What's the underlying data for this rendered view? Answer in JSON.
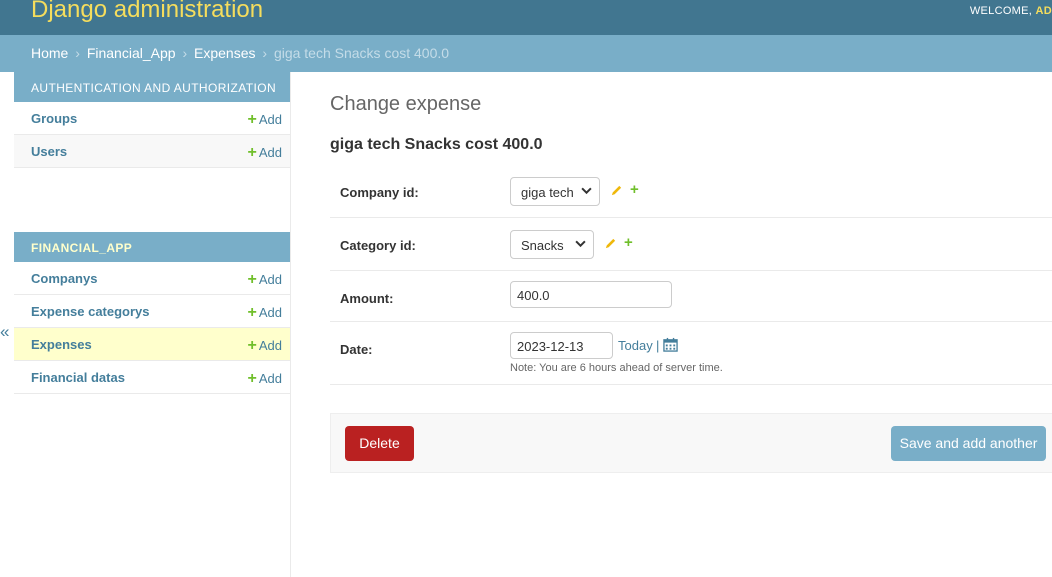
{
  "header": {
    "site_name": "Django administration",
    "welcome": "WELCOME,",
    "user": "AD"
  },
  "breadcrumbs": {
    "home": "Home",
    "app": "Financial_App",
    "model": "Expenses",
    "current": "giga tech Snacks cost 400.0",
    "separator": "›"
  },
  "sidebar": {
    "toggle": "«",
    "modules": [
      {
        "caption": "Authentication and Authorization",
        "items": [
          {
            "label": "Groups",
            "add": "Add"
          },
          {
            "label": "Users",
            "add": "Add"
          }
        ]
      },
      {
        "caption": "Financial_App",
        "items": [
          {
            "label": "Companys",
            "add": "Add"
          },
          {
            "label": "Expense categorys",
            "add": "Add"
          },
          {
            "label": "Expenses",
            "add": "Add"
          },
          {
            "label": "Financial datas",
            "add": "Add"
          }
        ]
      }
    ]
  },
  "content": {
    "title": "Change expense",
    "object_title": "giga tech Snacks cost 400.0",
    "fields": {
      "company": {
        "label": "Company id:",
        "value": "giga tech"
      },
      "category": {
        "label": "Category id:",
        "value": "Snacks"
      },
      "amount": {
        "label": "Amount:",
        "value": "400.0"
      },
      "date": {
        "label": "Date:",
        "value": "2023-12-13",
        "today": "Today",
        "pipe": "|",
        "help": "Note: You are 6 hours ahead of server time."
      }
    }
  },
  "actions": {
    "delete": "Delete",
    "save_add_another": "Save and add another"
  },
  "colors": {
    "header": "#417690",
    "breadcrumbs": "#79aec8",
    "delete": "#ba2121",
    "accent_yellow": "#f5dd5d"
  }
}
